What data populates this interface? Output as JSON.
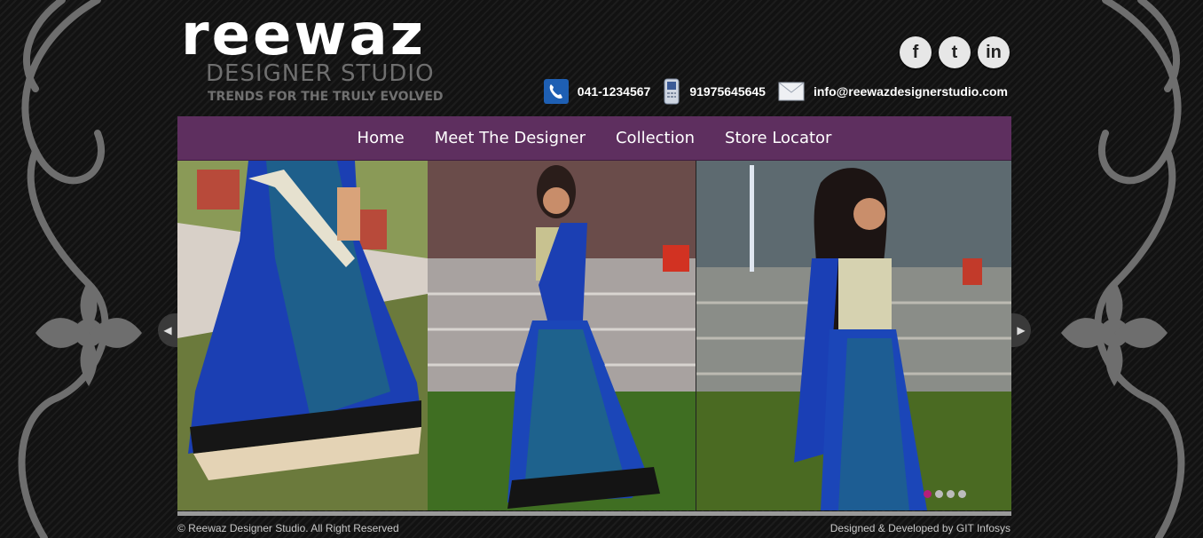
{
  "brand": {
    "logo_main": "reewaz",
    "logo_sub": "DESIGNER STUDIO",
    "tagline": "TRENDS FOR THE TRULY EVOLVED"
  },
  "social": [
    {
      "icon": "facebook-icon",
      "glyph": "f"
    },
    {
      "icon": "twitter-icon",
      "glyph": "t"
    },
    {
      "icon": "linkedin-icon",
      "glyph": "in"
    }
  ],
  "contacts": {
    "phone": "041-1234567",
    "mobile": "91975645645",
    "email": "info@reewazdesignerstudio.com"
  },
  "nav": [
    "Home",
    "Meet The Designer",
    "Collection",
    "Store Locator"
  ],
  "slider": {
    "slides": 4,
    "active": 1
  },
  "footer": {
    "copyright": "© Reewaz Designer Studio. All Right Reserved",
    "credit": "Designed & Developed by GIT Infosys"
  },
  "colors": {
    "nav_bg": "#5e2f5f",
    "active_dot": "#b51e7a"
  }
}
